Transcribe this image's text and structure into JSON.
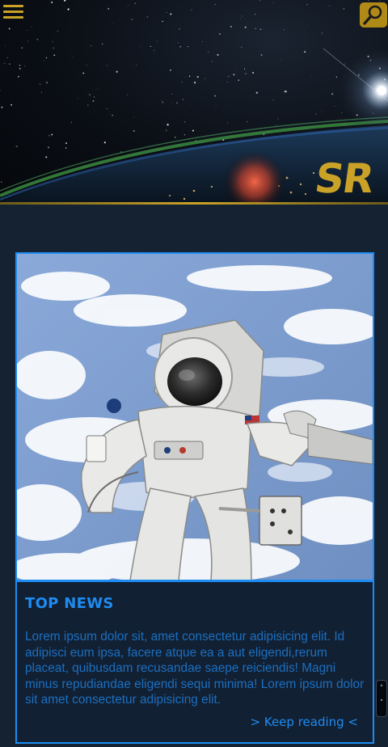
{
  "header": {
    "menu_icon": "hamburger-menu-icon",
    "search_icon": "magnifier-icon",
    "accent_color": "#c9a227"
  },
  "hero": {
    "logo_fragment": "SR"
  },
  "article": {
    "title": "TOP NEWS",
    "body": "Lorem ipsum dolor sit, amet consectetur adipisicing elit. Id adipisci eum ipsa, facere atque ea a aut eligendi,rerum placeat, quibusdam recusandae saepe reiciendis! Magni minus repudiandae eligendi sequi minima! Lorem ipsum dolor sit amet consectetur adipisicing elit.",
    "cta": "> Keep reading <",
    "image": "astronaut-spacewalk-photo",
    "accent_color": "#1d8cf2"
  },
  "scroll_widget": {
    "up_label": "˄",
    "down_label": "˄"
  }
}
